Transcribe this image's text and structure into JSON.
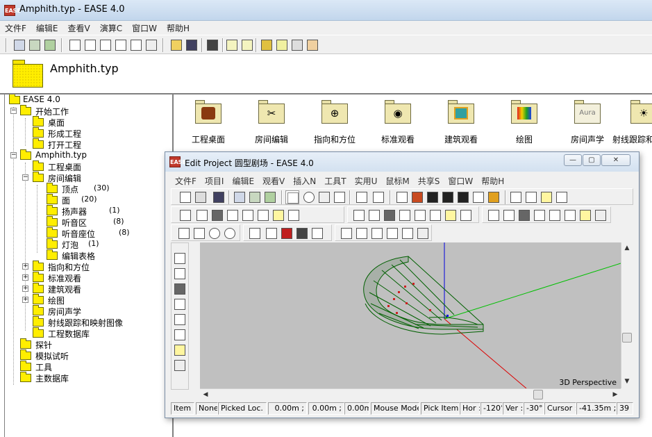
{
  "main_window": {
    "title": "Amphith.typ - EASE 4.0",
    "logo_text": "EASE"
  },
  "menu": [
    "文件F",
    "编辑E",
    "查看V",
    "演算C",
    "窗口W",
    "帮助H"
  ],
  "header": {
    "title": "Amphith.typ"
  },
  "tree": {
    "root": "EASE 4.0",
    "start_work": "开始工作",
    "desktop": "桌面",
    "form_project": "形成工程",
    "open_project": "打开工程",
    "amphith": "Amphith.typ",
    "project_desktop": "工程桌面",
    "room_edit": "房间编辑",
    "vertices": "顶点",
    "vertices_count": "(30)",
    "faces": "面",
    "faces_count": "(20)",
    "speakers": "扬声器",
    "speakers_count": "(1)",
    "audience_areas": "听音区",
    "audience_count": "(8)",
    "seats": "听音座位",
    "seats_count": "(8)",
    "bulbs": "灯泡",
    "bulbs_count": "(1)",
    "edit_table": "编辑表格",
    "orientation": "指向和方位",
    "standard_view": "标准观看",
    "architectural_view": "建筑观看",
    "drawing": "绘图",
    "room_acoustics": "房间声学",
    "ray_tracing": "射线跟踪和映射图像",
    "project_database": "工程数据库",
    "probe": "探针",
    "auralization": "模拟试听",
    "tools": "工具",
    "main_database": "主数据库"
  },
  "icons": [
    {
      "label": "工程桌面"
    },
    {
      "label": "房间编辑"
    },
    {
      "label": "指向和方位"
    },
    {
      "label": "标准观看"
    },
    {
      "label": "建筑观看"
    },
    {
      "label": "绘图"
    },
    {
      "label": "房间声学",
      "glyph": "Aura"
    },
    {
      "label": "射线跟踪和"
    }
  ],
  "child_window": {
    "title": "Edit Project 圆型剧场          - EASE 4.0",
    "menu": [
      "文件F",
      "项目I",
      "编辑E",
      "观看V",
      "插入N",
      "工具T",
      "实用U",
      "鼠标M",
      "共享S",
      "窗口W",
      "帮助H"
    ],
    "viewport_label": "3D Perspective",
    "status": {
      "item_label": "Item :",
      "item_value": "None",
      "picked_label": "Picked Loc. :",
      "x": "0.00m ;",
      "y": "0.00m ;",
      "z": "0.00m",
      "mouse_mode_label": "Mouse Mode :",
      "mouse_mode_value": "Pick Item",
      "hor_label": "Hor :",
      "hor_value": "-120°",
      "ver_label": "Ver :",
      "ver_value": "-30°",
      "cursor_label": "Cursor :",
      "cursor_value": "-41.35m ;",
      "extra": "39"
    }
  },
  "colors": {
    "folder": "#ffee00",
    "viewport_bg": "#c0c0c0",
    "axis_x": "#dd0000",
    "axis_y": "#00c000",
    "axis_z": "#0000dd",
    "mesh": "#006000"
  }
}
